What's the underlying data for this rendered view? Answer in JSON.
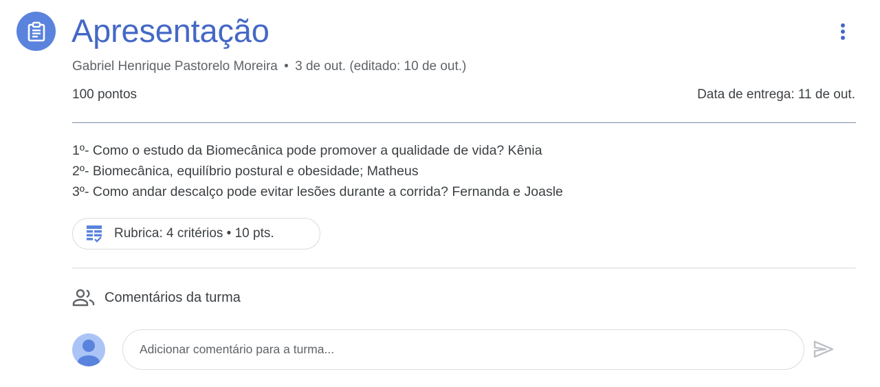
{
  "assignment": {
    "title": "Apresentação",
    "icon": "assignment-clipboard-icon",
    "accent_color": "#4468c5",
    "author": "Gabriel Henrique Pastorelo Moreira",
    "separator": "•",
    "date": "3 de out. (editado: 10 de out.)",
    "points": "100 pontos",
    "due": "Data de entrega: 11 de out.",
    "description": [
      "1º- Como o estudo da Biomecânica pode promover a qualidade de vida? Kênia",
      "2º- Biomecânica, equilíbrio postural e obesidade; Matheus",
      "3º- Como andar descalço pode evitar lesões durante a corrida? Fernanda e Joasle"
    ],
    "rubric": {
      "label": "Rubrica: 4 critérios • 10 pts.",
      "icon": "rubric-icon"
    }
  },
  "comments": {
    "header": "Comentários da turma",
    "header_icon": "people-icon",
    "input_placeholder": "Adicionar comentário para a turma...",
    "send_icon": "send-icon",
    "avatar_icon": "default-avatar-icon"
  },
  "more_icon": "more-vert-icon"
}
